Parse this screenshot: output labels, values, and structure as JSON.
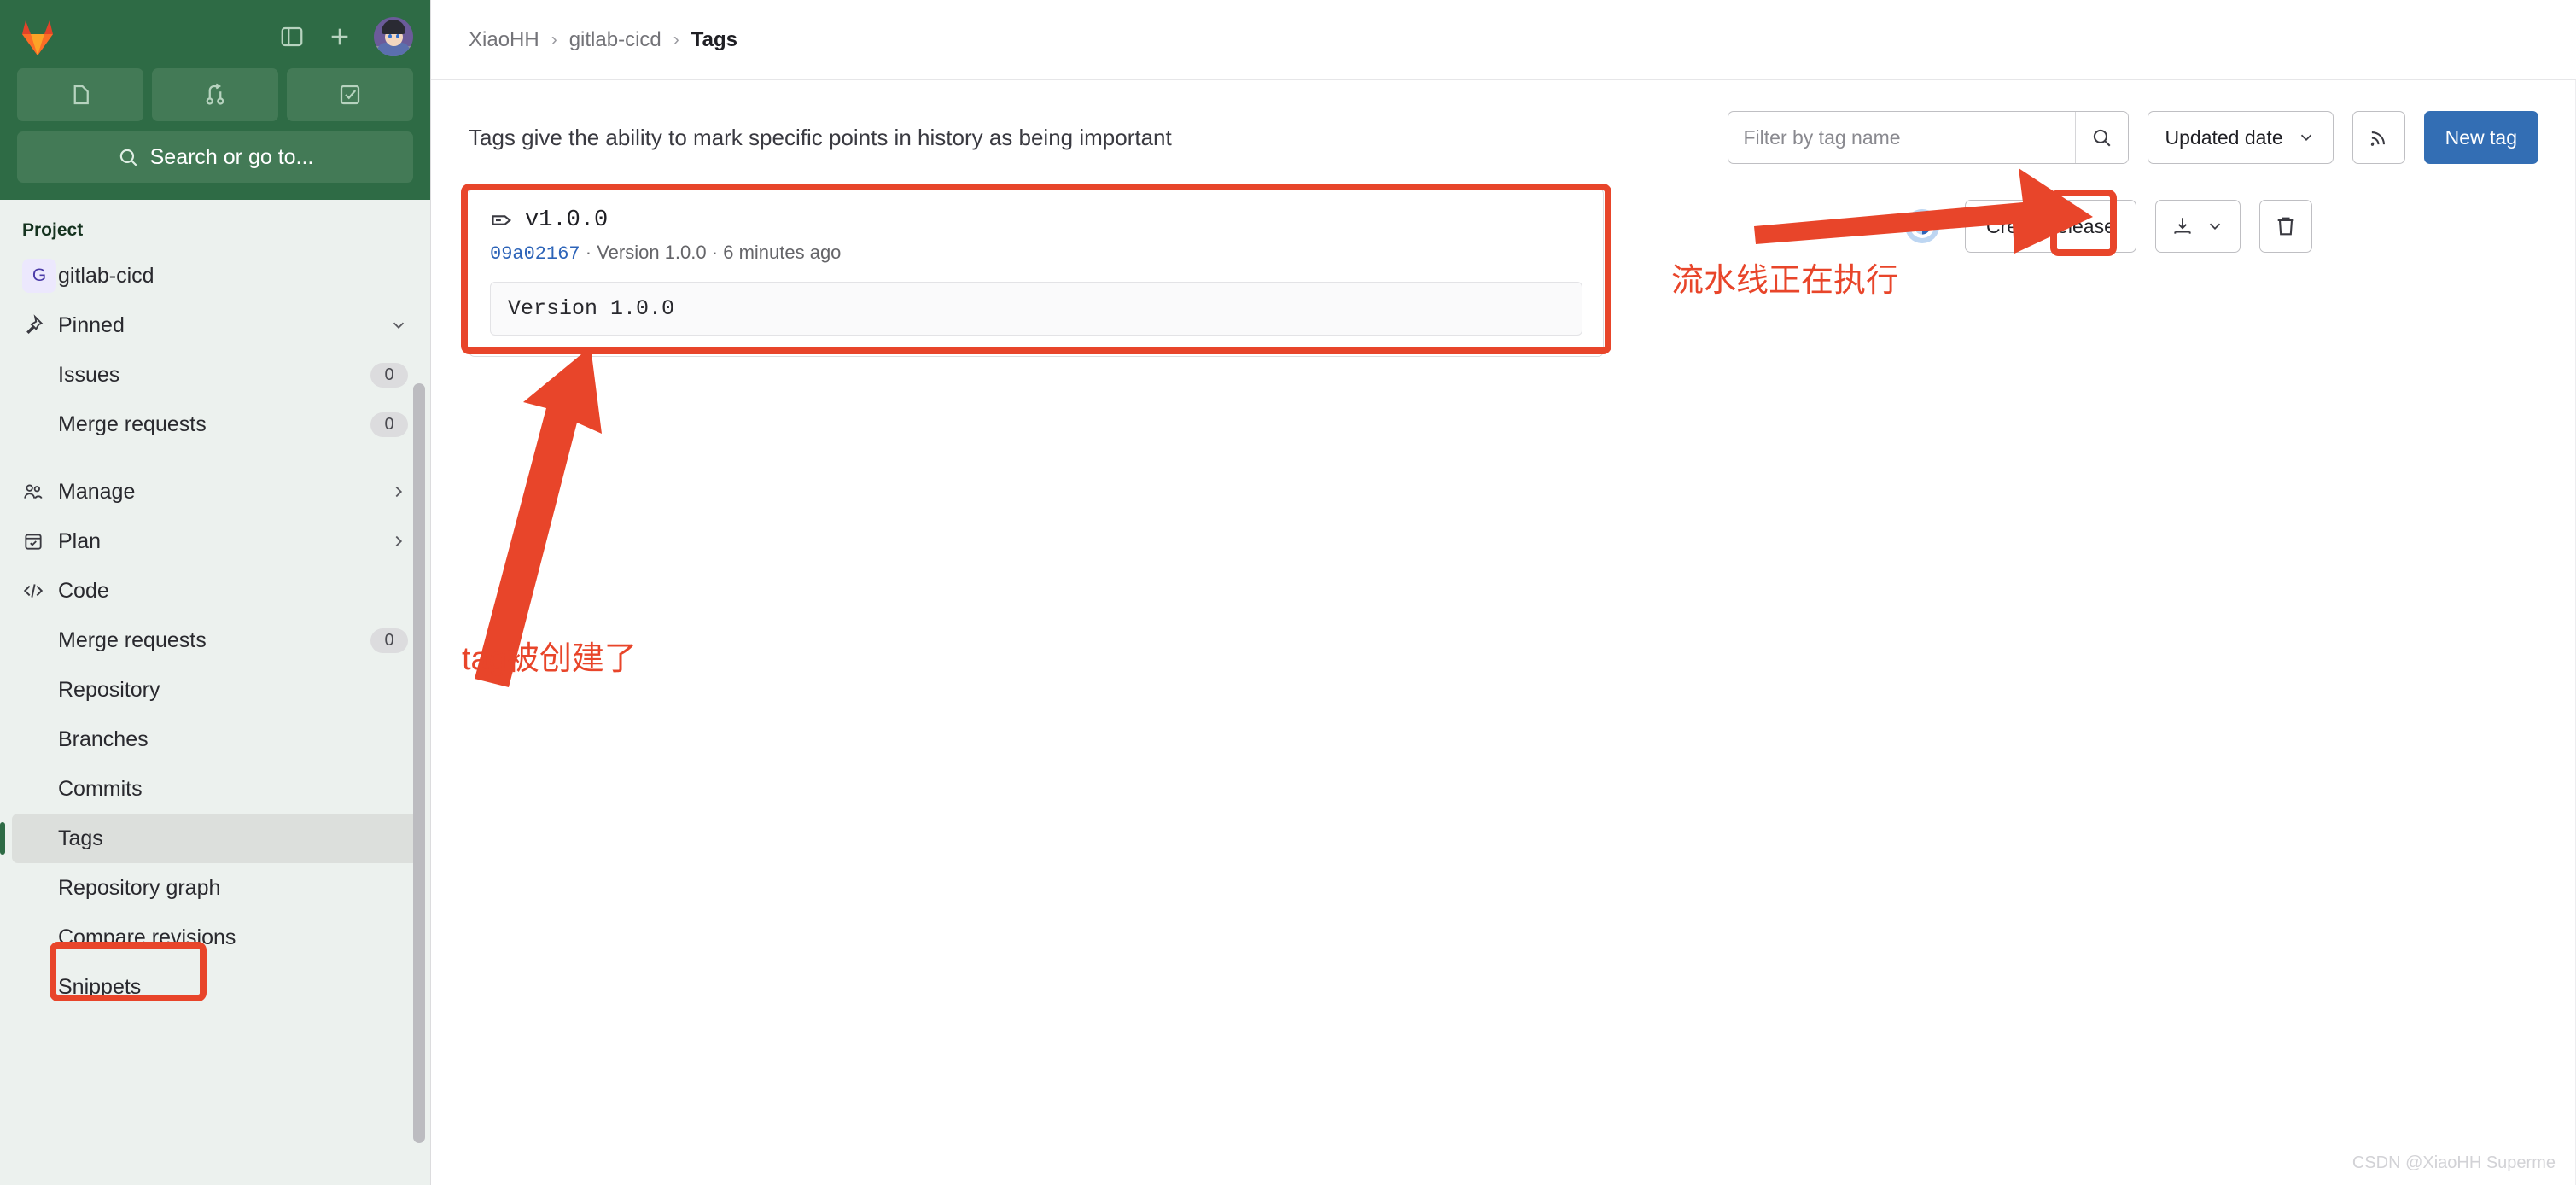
{
  "sidebar": {
    "top": {
      "logo": "gitlab-logo",
      "toggle_sidebar_label": "Toggle sidebar",
      "create_new_label": "Create new",
      "avatar_label": "User avatar",
      "quick_actions": [
        {
          "name": "issues-quick",
          "icon": "issue-icon"
        },
        {
          "name": "merge-requests-quick",
          "icon": "merge-request-icon"
        },
        {
          "name": "todos-quick",
          "icon": "todo-check-icon"
        }
      ],
      "search_placeholder": "Search or go to..."
    },
    "section_title": "Project",
    "project": {
      "initial": "G",
      "name": "gitlab-cicd"
    },
    "items": [
      {
        "label": "Pinned",
        "icon": "pin-icon",
        "type": "group",
        "chevron": "down",
        "badge": ""
      },
      {
        "label": "Issues",
        "icon": "",
        "type": "child",
        "badge": "0"
      },
      {
        "label": "Merge requests",
        "icon": "",
        "type": "child",
        "badge": "0"
      },
      {
        "label": "Manage",
        "icon": "users-icon",
        "type": "group",
        "chevron": "right",
        "badge": ""
      },
      {
        "label": "Plan",
        "icon": "calendar-icon",
        "type": "group",
        "chevron": "right",
        "badge": ""
      },
      {
        "label": "Code",
        "icon": "code-icon",
        "type": "group",
        "chevron": "",
        "badge": ""
      },
      {
        "label": "Merge requests",
        "icon": "",
        "type": "child",
        "badge": "0"
      },
      {
        "label": "Repository",
        "icon": "",
        "type": "child",
        "badge": ""
      },
      {
        "label": "Branches",
        "icon": "",
        "type": "child",
        "badge": ""
      },
      {
        "label": "Commits",
        "icon": "",
        "type": "child",
        "badge": ""
      },
      {
        "label": "Tags",
        "icon": "",
        "type": "child",
        "badge": "",
        "active": true
      },
      {
        "label": "Repository graph",
        "icon": "",
        "type": "child",
        "badge": ""
      },
      {
        "label": "Compare revisions",
        "icon": "",
        "type": "child",
        "badge": ""
      },
      {
        "label": "Snippets",
        "icon": "",
        "type": "child",
        "badge": ""
      }
    ]
  },
  "breadcrumb": {
    "group": "XiaoHH",
    "project": "gitlab-cicd",
    "current": "Tags",
    "separator": "›"
  },
  "main": {
    "description": "Tags give the ability to mark specific points in history as being important",
    "toolbar": {
      "filter_placeholder": "Filter by tag name",
      "filter_value": "",
      "search_icon": "search-icon",
      "sort_label": "Updated date",
      "sort_chevron": "chevron-down-icon",
      "rss_icon": "rss-icon",
      "new_tag_label": "New tag"
    },
    "tag": {
      "icon": "tag-icon",
      "name": "v1.0.0",
      "sha": "09a02167",
      "meta_separator": "·",
      "meta_title": "Version 1.0.0",
      "meta_time": "6 minutes ago",
      "message": "Version 1.0.0",
      "pipeline_status": "running",
      "actions": {
        "create_release_label": "Create release",
        "download_icon": "download-icon",
        "download_chevron": "chevron-down-icon",
        "delete_icon": "trash-icon"
      }
    }
  },
  "annotations": {
    "tag_created": "tag被创建了",
    "pipeline_running": "流水线正在执行",
    "color": "#e8452a"
  },
  "watermark": "CSDN @XiaoHH Superme"
}
